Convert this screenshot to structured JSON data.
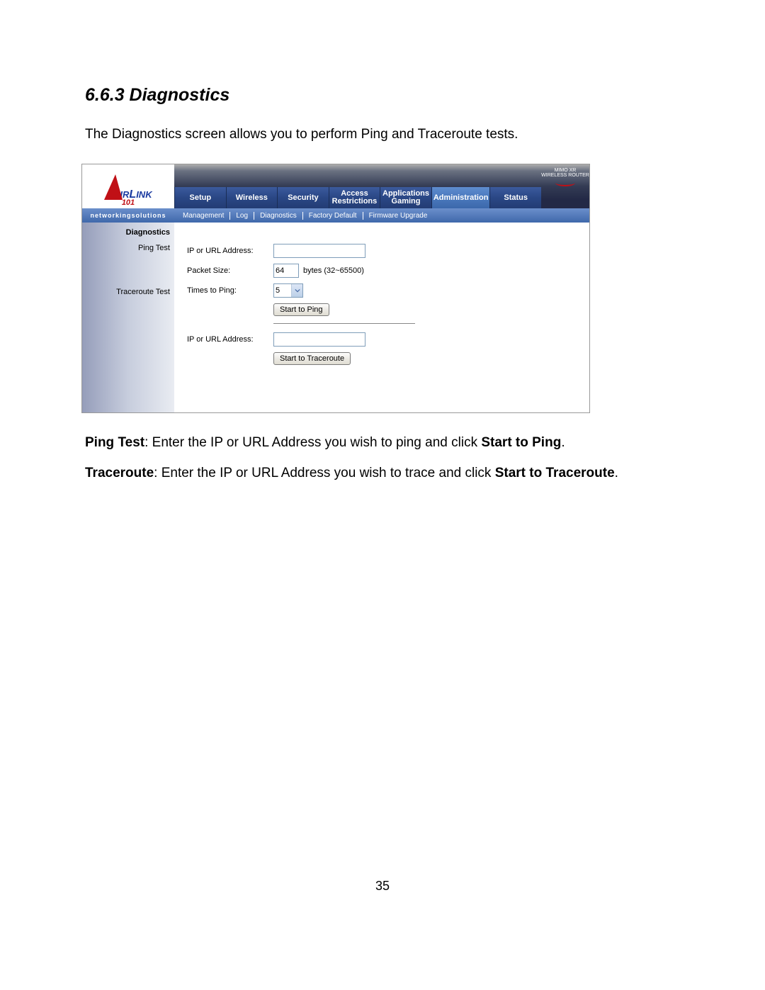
{
  "doc": {
    "heading": "6.6.3 Diagnostics",
    "intro": "The Diagnostics screen allows you to perform Ping and Traceroute tests.",
    "ping_bold": "Ping Test",
    "ping_text": ": Enter the IP or URL Address you wish to ping and click ",
    "ping_button_ref": "Start to Ping",
    "ping_period": ".",
    "tr_bold": "Traceroute",
    "tr_text": ": Enter the IP or URL Address you wish to trace and click ",
    "tr_button_ref": "Start to Traceroute",
    "tr_period": ".",
    "page_number": "35"
  },
  "logo": {
    "wordmark_ir": "IR",
    "wordmark_link": "L",
    "wordmark_ink": "INK",
    "sub": "101",
    "slogan": "networkingsolutions"
  },
  "brand_right": {
    "line1": "MIMO XR",
    "line2": "WIRELESS ROUTER"
  },
  "tabs": {
    "setup": "Setup",
    "wireless": "Wireless",
    "security": "Security",
    "access": "Access Restrictions",
    "apps": "Applications Gaming",
    "admin": "Administration",
    "status": "Status"
  },
  "subnav": {
    "management": "Management",
    "log": "Log",
    "diagnostics": "Diagnostics",
    "factory": "Factory Default",
    "firmware": "Firmware Upgrade"
  },
  "sidebar": {
    "heading": "Diagnostics",
    "ping": "Ping Test",
    "traceroute": "Traceroute Test"
  },
  "form": {
    "ip_label": "IP or URL Address:",
    "packet_label": "Packet Size:",
    "packet_value": "64",
    "packet_note": "bytes (32~65500)",
    "times_label": "Times to Ping:",
    "times_value": "5",
    "ping_button": "Start to Ping",
    "tr_ip_label": "IP or URL Address:",
    "tr_button": "Start to Traceroute"
  }
}
